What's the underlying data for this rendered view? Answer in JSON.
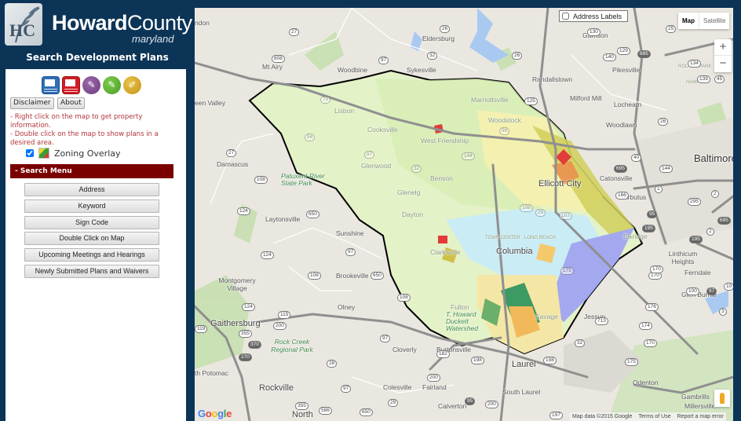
{
  "brand": {
    "logo_initials": "HC",
    "name_bold": "Howard",
    "name_light": "County",
    "subtitle": "maryland",
    "app_title": "Search Development Plans"
  },
  "toolbar": {
    "icons": [
      {
        "name": "blue-window-icon",
        "color": "#2f6fb6"
      },
      {
        "name": "red-window-icon",
        "color": "#d21d25"
      },
      {
        "name": "purple-eraser-icon",
        "color": "#7b4690"
      },
      {
        "name": "green-eraser-icon",
        "color": "#5aab32"
      },
      {
        "name": "gold-pen-icon",
        "color": "#d6a628"
      }
    ],
    "disclaimer_label": "Disclaimer",
    "about_label": "About"
  },
  "hints": {
    "right_click": "- Right click on the map to get property information.",
    "double_click": "- Double click on the map to show plans in a desired area."
  },
  "overlay": {
    "label": "Zoning Overlay",
    "checked": true
  },
  "search_menu": {
    "header": "- Search Menu",
    "header_color": "#7a0000",
    "items": [
      {
        "label": "Address"
      },
      {
        "label": "Keyword"
      },
      {
        "label": "Sign Code"
      },
      {
        "label": "Double Click on Map"
      },
      {
        "label": "Upcoming Meetings and Hearings"
      },
      {
        "label": "Newly Submitted Plans and Waivers"
      }
    ]
  },
  "map": {
    "address_labels": {
      "label": "Address Labels",
      "checked": false
    },
    "map_type": {
      "map": "Map",
      "satellite": "Satellite",
      "selected": "Map"
    },
    "zoom_in": "+",
    "zoom_out": "−",
    "attribution": {
      "data": "Map data ©2015 Google",
      "terms": "Terms of Use",
      "report": "Report a map error"
    },
    "google_logo": [
      "G",
      "o",
      "o",
      "g",
      "l",
      "e"
    ],
    "places": [
      {
        "name": "ndon"
      },
      {
        "name": "Mt Airy"
      },
      {
        "name": "Woodbine"
      },
      {
        "name": "Eldersburg"
      },
      {
        "name": "Sykesville"
      },
      {
        "name": "Randallstown"
      },
      {
        "name": "Garrison"
      },
      {
        "name": "Pikesville"
      },
      {
        "name": "Milford Mill"
      },
      {
        "name": "Lochearn"
      },
      {
        "name": "Woodlawn"
      },
      {
        "name": "Baltimore"
      },
      {
        "name": "Catonsville"
      },
      {
        "name": "Arbutus"
      },
      {
        "name": "Ellicott City"
      },
      {
        "name": "Lisbon"
      },
      {
        "name": "Cooksville"
      },
      {
        "name": "West Friendship"
      },
      {
        "name": "Marriottsville"
      },
      {
        "name": "Woodstock"
      },
      {
        "name": "Glenwood"
      },
      {
        "name": "Benson"
      },
      {
        "name": "Glenelg"
      },
      {
        "name": "Dayton"
      },
      {
        "name": "Clarksville"
      },
      {
        "name": "Columbia"
      },
      {
        "name": "Damascus"
      },
      {
        "name": "een Valley"
      },
      {
        "name": "Patuxent River State Park"
      },
      {
        "name": "Laytonsville"
      },
      {
        "name": "Sunshine"
      },
      {
        "name": "Brookeville"
      },
      {
        "name": "Montgomery Village"
      },
      {
        "name": "Olney"
      },
      {
        "name": "Gaithersburg"
      },
      {
        "name": "Rock Creek Regional Park"
      },
      {
        "name": "Cloverly"
      },
      {
        "name": "Burtonsville"
      },
      {
        "name": "Fulton"
      },
      {
        "name": "Savage"
      },
      {
        "name": "Jessup"
      },
      {
        "name": "Laurel"
      },
      {
        "name": "South Laurel"
      },
      {
        "name": "Fairland"
      },
      {
        "name": "Calverton"
      },
      {
        "name": "Colesville"
      },
      {
        "name": "Rockville"
      },
      {
        "name": "North"
      },
      {
        "name": "th Potomac"
      },
      {
        "name": "Linthicum Heights"
      },
      {
        "name": "Ferndale"
      },
      {
        "name": "Glen Burnie"
      },
      {
        "name": "Odenton"
      },
      {
        "name": "Gambrills"
      },
      {
        "name": "Millersville"
      },
      {
        "name": "Elkridge"
      },
      {
        "name": "ROLAND PARK"
      },
      {
        "name": "HAMPDEN"
      },
      {
        "name": "TOWN CENTER"
      },
      {
        "name": "LONG REACH"
      },
      {
        "name": "T. Howard Duckett Watershed"
      }
    ],
    "shields": [
      "27",
      "808",
      "97",
      "26",
      "32",
      "26",
      "125",
      "130",
      "129",
      "140",
      "695",
      "25",
      "134",
      "139",
      "45",
      "26",
      "40",
      "144",
      "695",
      "1",
      "166",
      "295",
      "95",
      "195",
      "2",
      "70",
      "94",
      "97",
      "32",
      "144",
      "99",
      "108",
      "29",
      "103",
      "175",
      "27",
      "108",
      "124",
      "650",
      "97",
      "124",
      "108",
      "650",
      "108",
      "124",
      "115",
      "200",
      "355",
      "370",
      "270",
      "28",
      "97",
      "182",
      "200",
      "119",
      "198",
      "198",
      "32",
      "713",
      "176",
      "170",
      "174",
      "170",
      "175",
      "100",
      "97",
      "3",
      "10",
      "195",
      "170",
      "2",
      "695",
      "650",
      "29",
      "95",
      "200",
      "197",
      "586",
      "97",
      "355"
    ]
  }
}
